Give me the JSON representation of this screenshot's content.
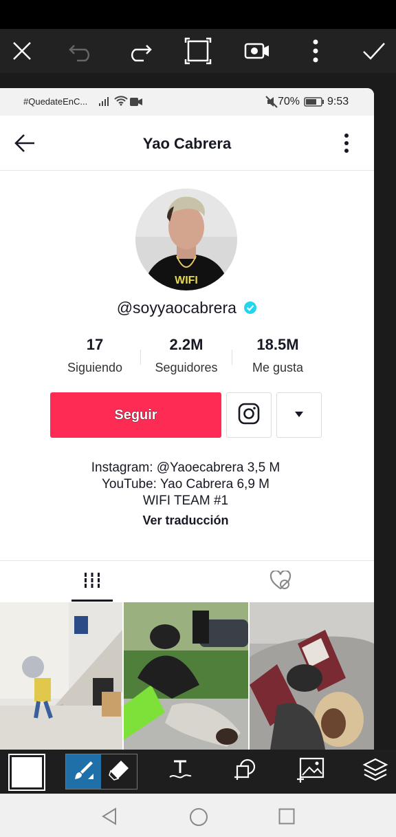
{
  "app": {
    "top_toolbar": [
      "close",
      "undo",
      "redo",
      "crop",
      "record",
      "more",
      "apply"
    ],
    "bottom_toolbar": [
      "color",
      "brush",
      "eraser",
      "text",
      "sticker",
      "add-photo",
      "layers"
    ]
  },
  "status_bar": {
    "hashtag": "#QuedateEnC...",
    "battery": "70%",
    "time": "9:53"
  },
  "profile": {
    "name": "Yao Cabrera",
    "handle": "@soyyaocabrera",
    "verified": true,
    "stats": [
      {
        "value": "17",
        "label": "Siguiendo"
      },
      {
        "value": "2.2M",
        "label": "Seguidores"
      },
      {
        "value": "18.5M",
        "label": "Me gusta"
      }
    ],
    "follow_label": "Seguir",
    "bio_lines": [
      "Instagram: @Yaoecabrera 3,5 M",
      "YouTube: Yao Cabrera 6,9 M",
      "WIFI TEAM #1"
    ],
    "translate_label": "Ver traducción",
    "avatar_shirt_text": "WIFI"
  },
  "colors": {
    "follow": "#fe2c55",
    "verified": "#20d5ec",
    "selected_tool": "#1f6fa8"
  }
}
